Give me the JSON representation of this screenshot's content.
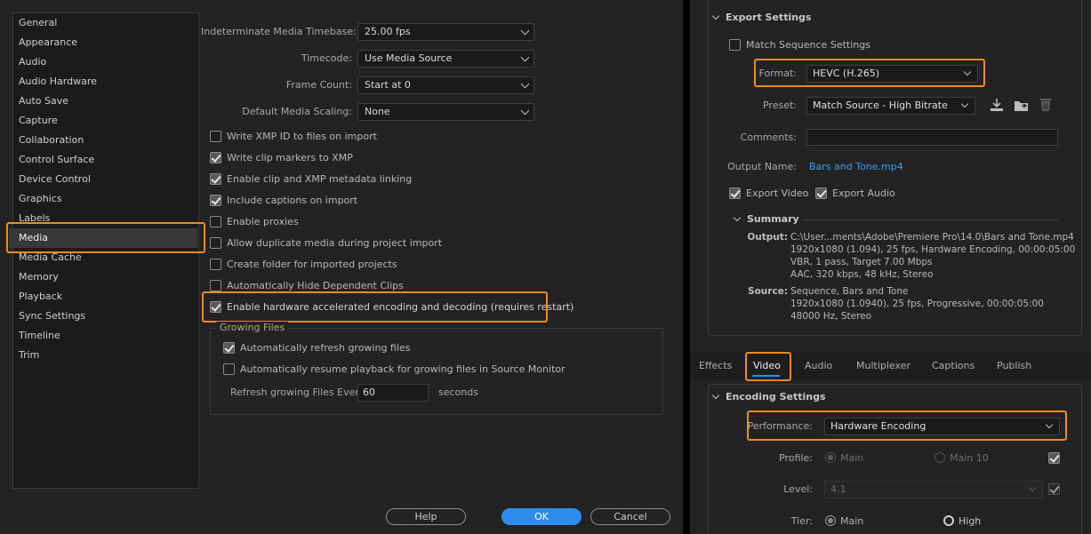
{
  "categories": [
    "General",
    "Appearance",
    "Audio",
    "Audio Hardware",
    "Auto Save",
    "Capture",
    "Collaboration",
    "Control Surface",
    "Device Control",
    "Graphics",
    "Labels",
    "Media",
    "Media Cache",
    "Memory",
    "Playback",
    "Sync Settings",
    "Timeline",
    "Trim"
  ],
  "selected_category": "Media",
  "media": {
    "timebase_label": "Indeterminate Media Timebase:",
    "timebase_value": "25.00 fps",
    "timecode_label": "Timecode:",
    "timecode_value": "Use Media Source",
    "framecount_label": "Frame Count:",
    "framecount_value": "Start at 0",
    "scaling_label": "Default Media Scaling:",
    "scaling_value": "None",
    "checkboxes": [
      {
        "label": "Write XMP ID to files on import",
        "checked": false
      },
      {
        "label": "Write clip markers to XMP",
        "checked": true
      },
      {
        "label": "Enable clip and XMP metadata linking",
        "checked": true
      },
      {
        "label": "Include captions on import",
        "checked": true
      },
      {
        "label": "Enable proxies",
        "checked": false
      },
      {
        "label": "Allow duplicate media during project import",
        "checked": false
      },
      {
        "label": "Create folder for imported projects",
        "checked": false
      },
      {
        "label": "Automatically Hide Dependent Clips",
        "checked": false
      },
      {
        "label": "Enable hardware accelerated encoding and decoding (requires restart)",
        "checked": true
      }
    ],
    "growing": {
      "title": "Growing Files",
      "refresh_label": "Automatically refresh growing files",
      "refresh_checked": true,
      "resume_label": "Automatically resume playback for growing files in Source Monitor",
      "resume_checked": false,
      "every_label": "Refresh growing Files Every",
      "every_value": "60",
      "every_unit": "seconds"
    }
  },
  "buttons": {
    "help": "Help",
    "ok": "OK",
    "cancel": "Cancel"
  },
  "export": {
    "section_title": "Export Settings",
    "match_label": "Match Sequence Settings",
    "format_label": "Format:",
    "format_value": "HEVC (H.265)",
    "preset_label": "Preset:",
    "preset_value": "Match Source - High Bitrate",
    "comments_label": "Comments:",
    "comments_value": "",
    "output_label": "Output Name:",
    "output_value": "Bars and Tone.mp4",
    "export_video_label": "Export Video",
    "export_audio_label": "Export Audio",
    "summary_title": "Summary",
    "summary_output_label": "Output:",
    "summary_output_lines": [
      "C:\\User...ments\\Adobe\\Premiere Pro\\14.0\\Bars and Tone.mp4",
      "1920x1080 (1.094), 25 fps, Hardware Encoding, 00:00:05:00",
      "VBR, 1 pass, Target 7.00 Mbps",
      "AAC, 320 kbps, 48 kHz, Stereo"
    ],
    "summary_source_label": "Source:",
    "summary_source_lines": [
      "Sequence, Bars and Tone",
      "1920x1080 (1.0940), 25 fps, Progressive, 00:00:05:00",
      "48000 Hz, Stereo"
    ]
  },
  "tabs": [
    "Effects",
    "Video",
    "Audio",
    "Multiplexer",
    "Captions",
    "Publish"
  ],
  "active_tab": "Video",
  "encoding": {
    "title": "Encoding Settings",
    "performance_label": "Performance:",
    "performance_value": "Hardware Encoding",
    "profile_label": "Profile:",
    "profile_opt1": "Main",
    "profile_opt2": "Main 10",
    "level_label": "Level:",
    "level_value": "4.1",
    "tier_label": "Tier:",
    "tier_opt1": "Main",
    "tier_opt2": "High"
  },
  "colors": {
    "accent": "#2d8ceb",
    "highlight": "#f08b1d",
    "link": "#3b9cf2"
  }
}
